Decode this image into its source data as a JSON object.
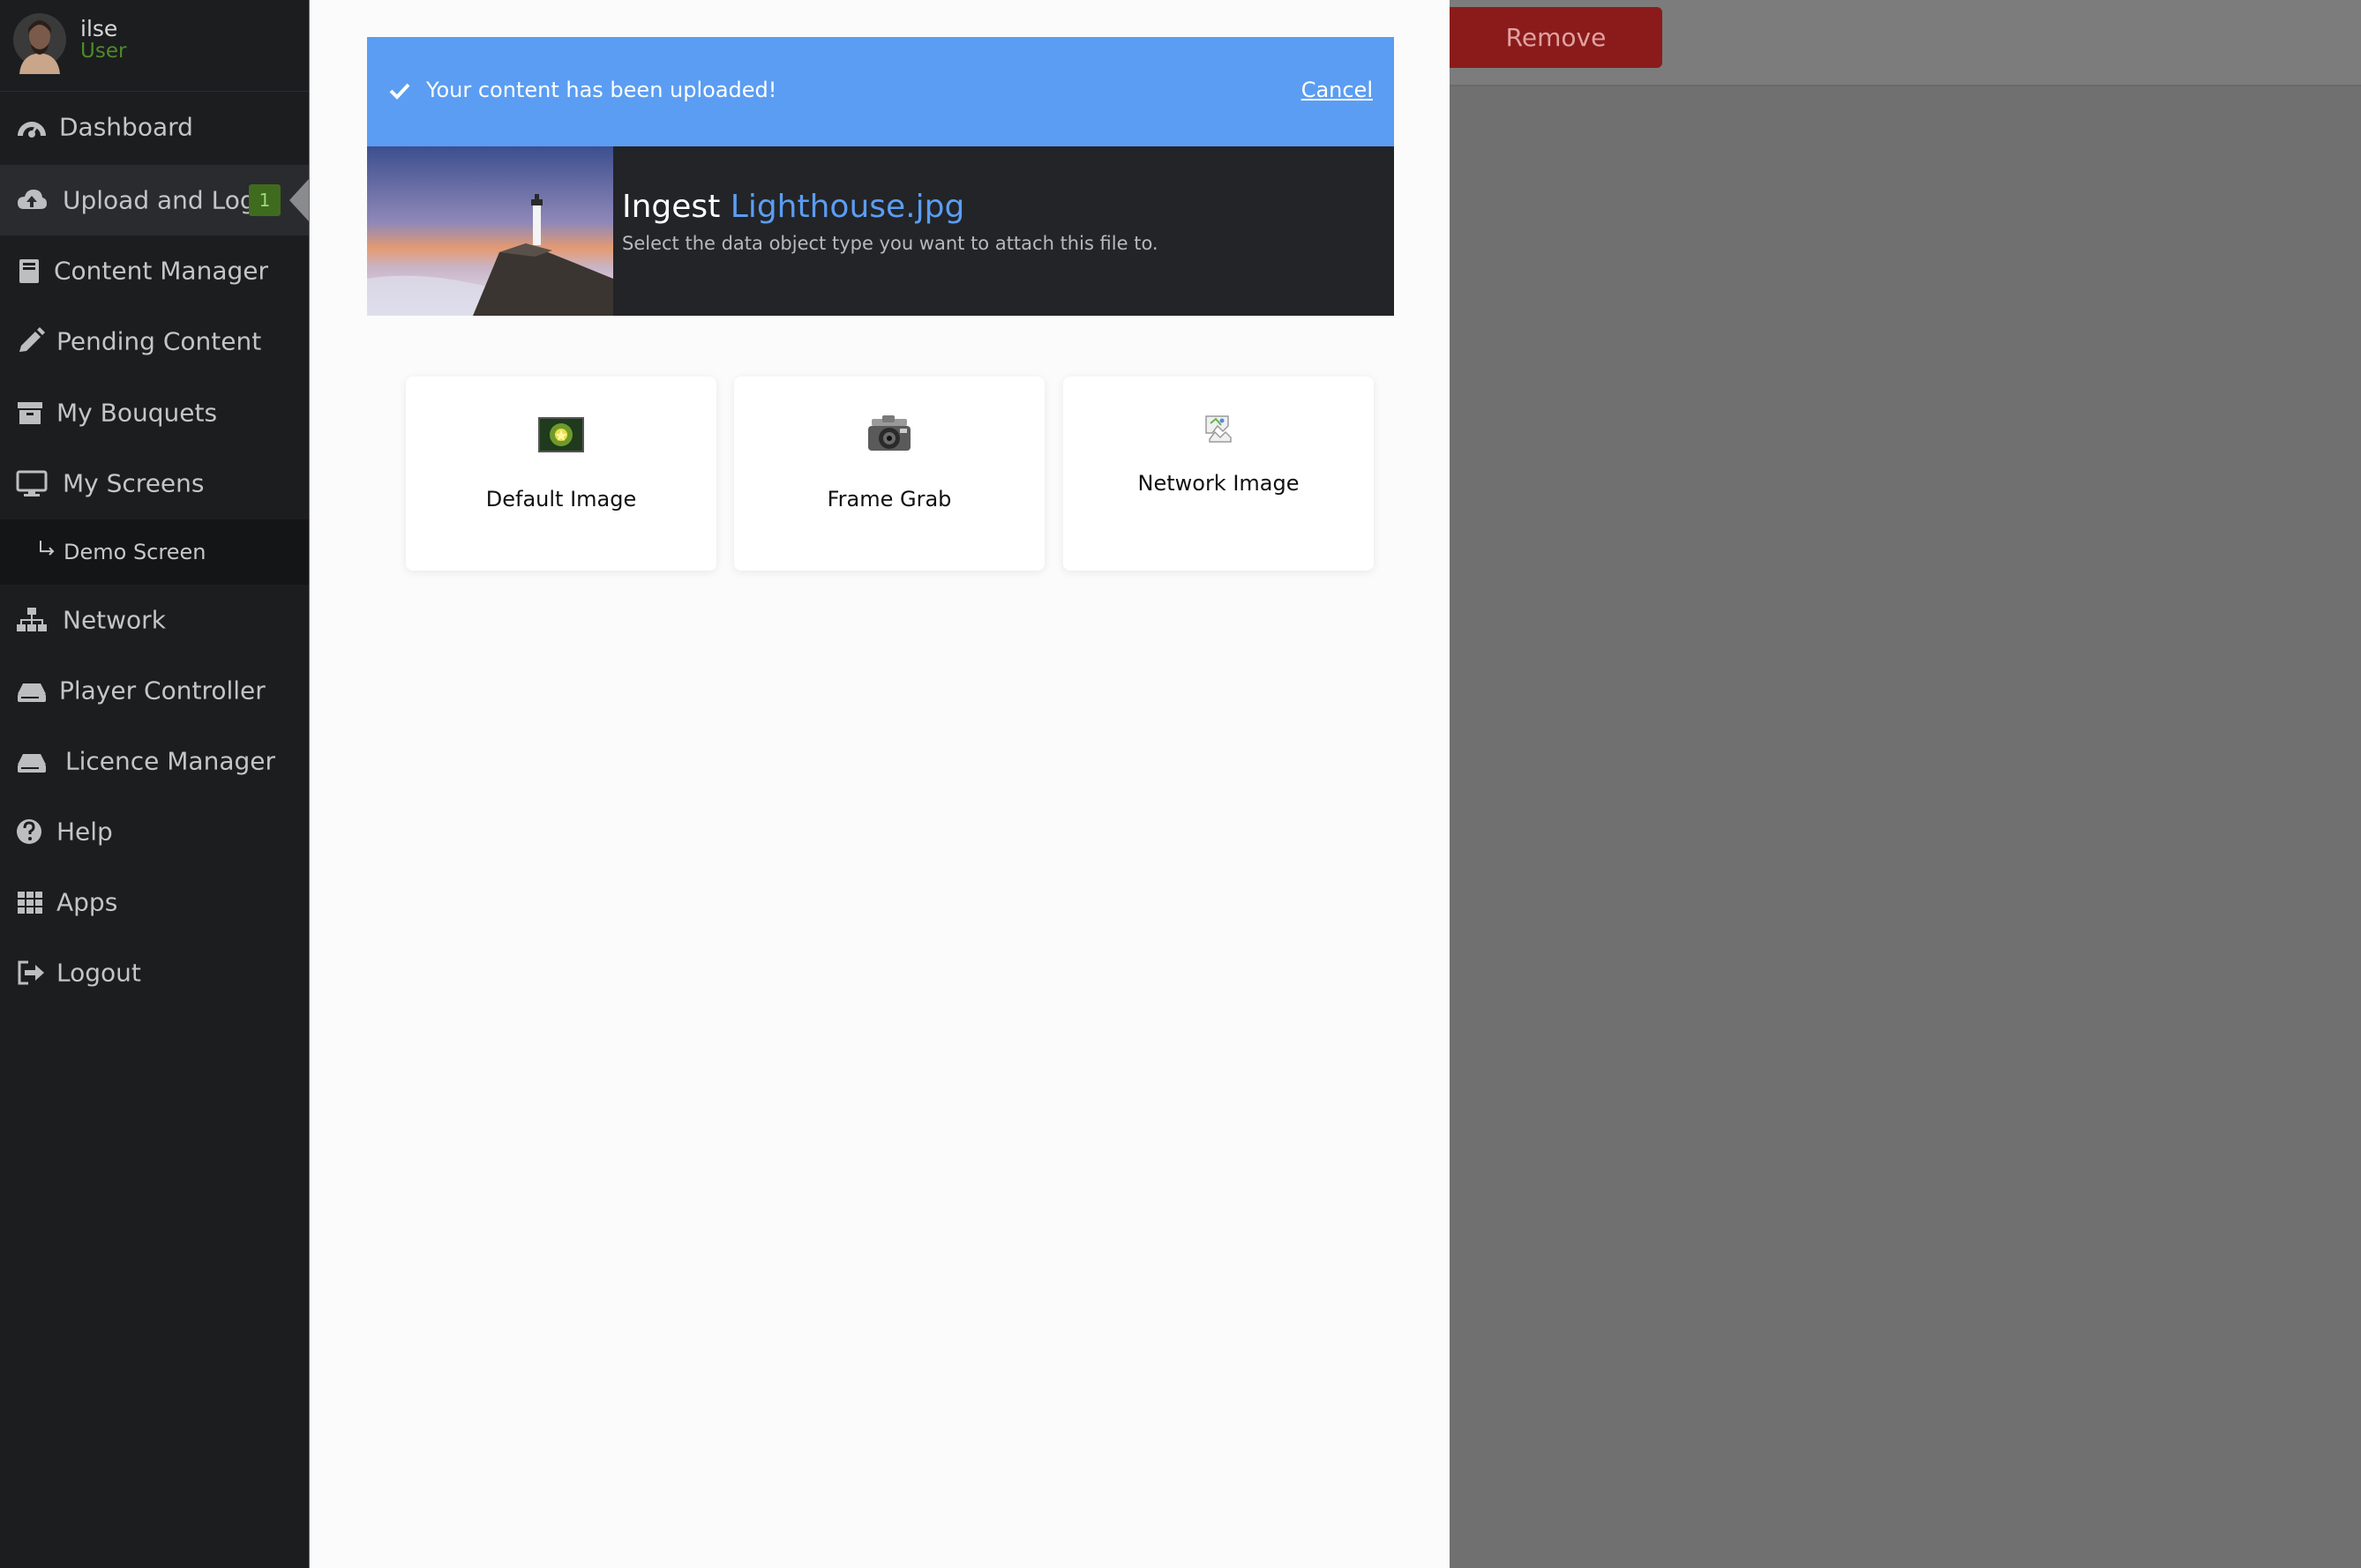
{
  "user": {
    "name": "ilse",
    "role": "User"
  },
  "sidebar": {
    "items": [
      {
        "label": "Dashboard",
        "icon": "dashboard-icon"
      },
      {
        "label": "Upload and Log",
        "icon": "cloud-upload-icon",
        "badge": "1"
      },
      {
        "label": "Content Manager",
        "icon": "book-icon"
      },
      {
        "label": "Pending Content",
        "icon": "pencil-icon"
      },
      {
        "label": "My Bouquets",
        "icon": "archive-icon"
      },
      {
        "label": "My Screens",
        "icon": "desktop-icon"
      },
      {
        "label": "Demo Screen",
        "icon": "sub-arrow-icon"
      },
      {
        "label": "Network",
        "icon": "sitemap-icon"
      },
      {
        "label": "Player Controller",
        "icon": "hdd-icon"
      },
      {
        "label": "Licence Manager",
        "icon": "hdd-icon"
      },
      {
        "label": "Help",
        "icon": "question-circle-icon"
      },
      {
        "label": "Apps",
        "icon": "grid-icon"
      },
      {
        "label": "Logout",
        "icon": "sign-out-icon"
      }
    ]
  },
  "modal": {
    "success_message": "Your content has been uploaded!",
    "cancel_label": "Cancel",
    "ingest_label": "Ingest",
    "filename": "Lighthouse.jpg",
    "subtitle": "Select the data object type you want to attach this file to.",
    "types": [
      {
        "label": "Default Image",
        "icon": "default-image-icon"
      },
      {
        "label": "Frame Grab",
        "icon": "camera-icon"
      },
      {
        "label": "Network Image",
        "icon": "broken-image-icon"
      }
    ]
  },
  "background": {
    "remove_label": "Remove"
  },
  "colors": {
    "accent": "#5b9df2",
    "sidebar_bg": "#1c1d1f",
    "badge": "#3f6b1f",
    "danger": "#8b1b1b"
  }
}
